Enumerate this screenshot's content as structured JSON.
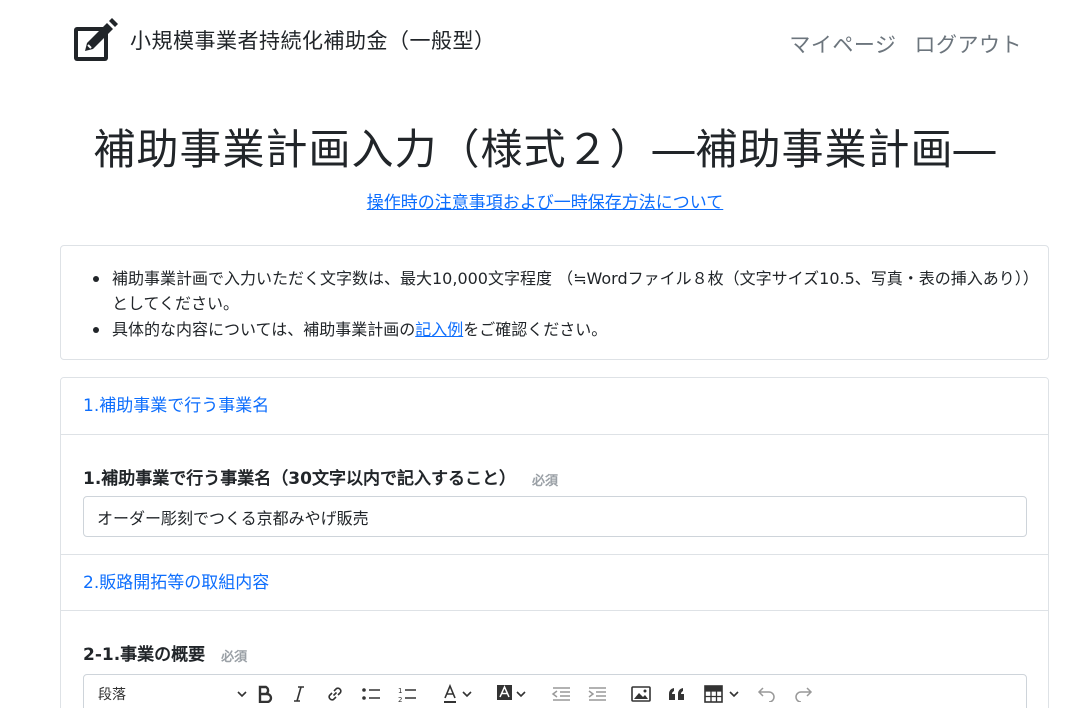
{
  "header": {
    "title": "小規模事業者持続化補助金（一般型）",
    "nav": {
      "mypage": "マイページ",
      "logout": "ログアウト"
    }
  },
  "page": {
    "title": "補助事業計画入力（様式２）―補助事業計画―",
    "guide_link": "操作時の注意事項および一時保存方法について"
  },
  "notice": {
    "item1": "補助事業計画で入力いただく文字数は、最大10,000文字程度 （≒Wordファイル８枚（文字サイズ10.5、写真・表の挿入あり））としてください。",
    "item2_before": "具体的な内容については、補助事業計画の",
    "item2_link": "記入例",
    "item2_after": "をご確認ください。"
  },
  "form": {
    "section1": {
      "heading": "1.補助事業で行う事業名",
      "field_label": "1.補助事業で行う事業名（30文字以内で記入すること）",
      "required": "必須",
      "value": "オーダー彫刻でつくる京都みやげ販売"
    },
    "section2": {
      "heading": "2.販路開拓等の取組内容",
      "field_label": "2-1.事業の概要",
      "required": "必須"
    }
  },
  "editor": {
    "heading_select": "段落",
    "icons": [
      "chevron-down-icon",
      "bold-icon",
      "italic-icon",
      "link-icon",
      "bulleted-list-icon",
      "numbered-list-icon",
      "font-color-icon",
      "highlight-icon",
      "outdent-icon",
      "indent-icon",
      "image-icon",
      "blockquote-icon",
      "table-icon",
      "undo-icon",
      "redo-icon"
    ]
  },
  "colors": {
    "accent": "#0d6efd",
    "text": "#212529",
    "muted": "#6c757d",
    "border": "#dee2e6"
  }
}
